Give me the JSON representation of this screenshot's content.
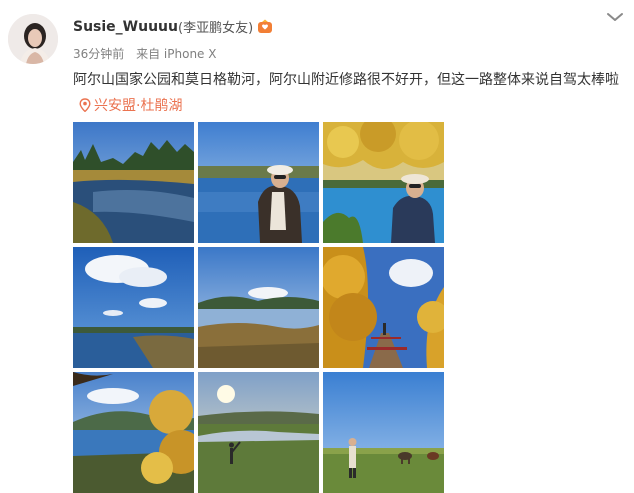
{
  "post": {
    "username": "Susie_Wuuuu",
    "remark": "(李亚鹏女友)",
    "time": "36分钟前",
    "source": "来自 iPhone X",
    "text": "阿尔山国家公园和莫日格勒河，阿尔山附近修路很不好开，但这一路整体来说自驾太棒啦",
    "location": "兴安盟·杜鹃湖"
  },
  "icons": {
    "avatar": "user-avatar",
    "badge": "fan-badge-icon",
    "menu": "chevron-down-icon",
    "location": "location-pin-icon"
  },
  "colors": {
    "username": "#333333",
    "meta": "#808080",
    "location": "#eb7350",
    "chevron": "#8a8a8a"
  },
  "photos": [
    {
      "alt": "river-with-forest"
    },
    {
      "alt": "man-by-lake"
    },
    {
      "alt": "man-under-autumn-tree"
    },
    {
      "alt": "lake-with-clouds"
    },
    {
      "alt": "wetland-lake"
    },
    {
      "alt": "autumn-birch-forest-stairs"
    },
    {
      "alt": "lake-through-autumn-branches"
    },
    {
      "alt": "grassland-sunset"
    },
    {
      "alt": "grassland-horses"
    }
  ]
}
